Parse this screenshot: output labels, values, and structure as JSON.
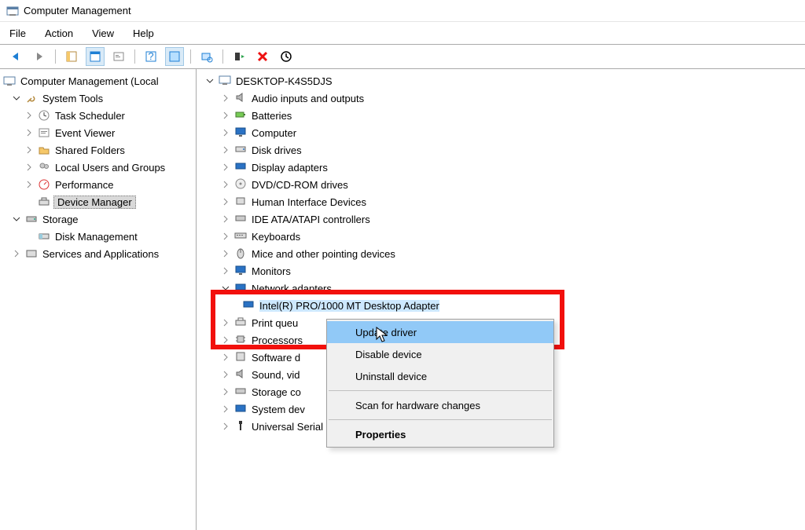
{
  "window": {
    "title": "Computer Management"
  },
  "menu": {
    "file": "File",
    "action": "Action",
    "view": "View",
    "help": "Help"
  },
  "left_tree": {
    "root": "Computer Management (Local",
    "system_tools": "System Tools",
    "st_children": {
      "task_scheduler": "Task Scheduler",
      "event_viewer": "Event Viewer",
      "shared_folders": "Shared Folders",
      "local_users": "Local Users and Groups",
      "performance": "Performance",
      "device_manager": "Device Manager"
    },
    "storage": "Storage",
    "storage_children": {
      "disk_management": "Disk Management"
    },
    "services": "Services and Applications"
  },
  "devices": {
    "root": "DESKTOP-K4S5DJS",
    "cats": {
      "audio": "Audio inputs and outputs",
      "batteries": "Batteries",
      "computer": "Computer",
      "disk": "Disk drives",
      "display": "Display adapters",
      "dvd": "DVD/CD-ROM drives",
      "hid": "Human Interface Devices",
      "ide": "IDE ATA/ATAPI controllers",
      "keyboards": "Keyboards",
      "mice": "Mice and other pointing devices",
      "monitors": "Monitors",
      "netadapters": "Network adapters",
      "netdevice": "Intel(R) PRO/1000 MT Desktop Adapter",
      "printq": "Print queu",
      "processors": "Processors",
      "soft": "Software d",
      "sound": "Sound, vid",
      "storagec": "Storage co",
      "sysdev": "System dev",
      "usb": "Universal Serial Bus controllers"
    }
  },
  "context_menu": {
    "update": "Update driver",
    "disable": "Disable device",
    "uninstall": "Uninstall device",
    "scan": "Scan for hardware changes",
    "properties": "Properties"
  }
}
